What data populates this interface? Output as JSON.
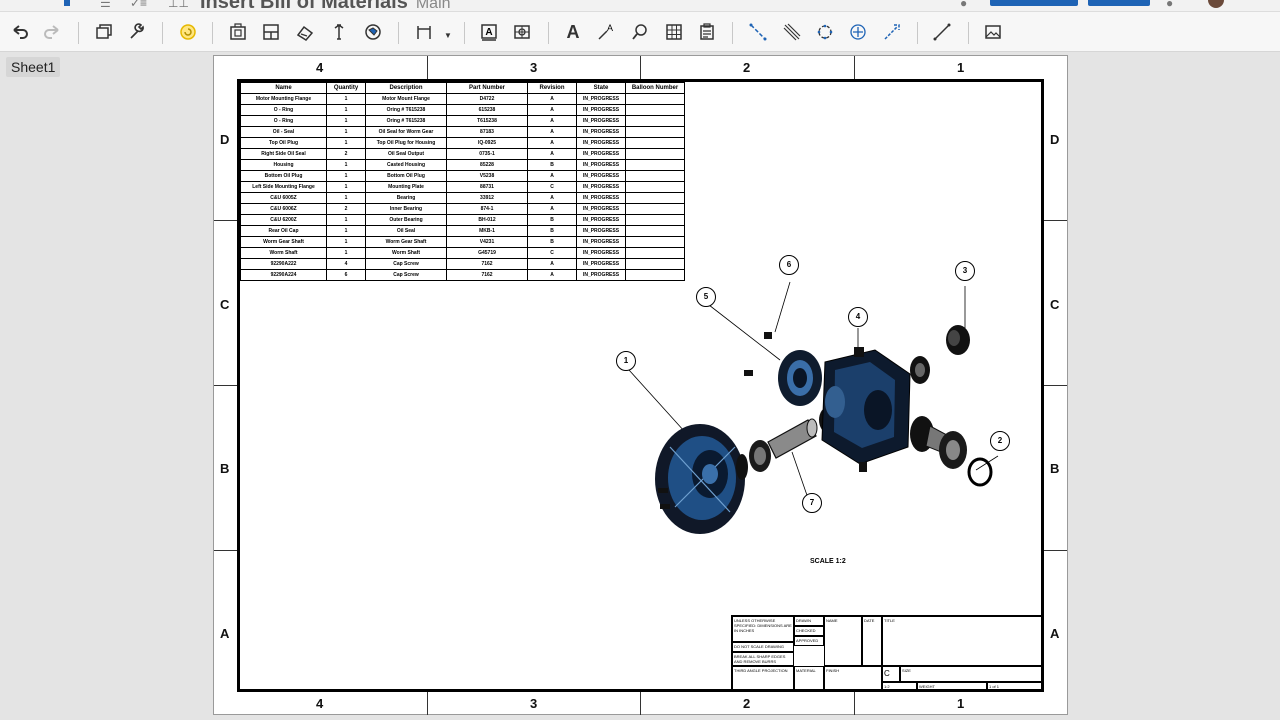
{
  "app": {
    "title": "Insert Bill of Materials",
    "subtitle": "Main",
    "colors": {
      "accent": "#1e63b5",
      "highlight_icon": "#e6b800"
    }
  },
  "toolbar": {
    "tools": [
      {
        "name": "undo-icon",
        "enabled": true
      },
      {
        "name": "redo-icon",
        "enabled": false
      },
      {
        "name": "insert-view-icon",
        "enabled": true
      },
      {
        "name": "wrench-icon",
        "enabled": true
      },
      {
        "name": "update-icon",
        "enabled": true
      },
      {
        "name": "insert-part-icon",
        "enabled": true
      },
      {
        "name": "section-view-icon",
        "enabled": true
      },
      {
        "name": "projected-view-icon",
        "enabled": true
      },
      {
        "name": "auxiliary-view-icon",
        "enabled": true
      },
      {
        "name": "detail-view-icon",
        "enabled": true
      },
      {
        "name": "dimension-icon",
        "enabled": true
      },
      {
        "name": "note-icon",
        "enabled": true
      },
      {
        "name": "datum-icon",
        "enabled": true
      },
      {
        "name": "text-icon",
        "enabled": true
      },
      {
        "name": "callout-icon",
        "enabled": true
      },
      {
        "name": "search-balloon-icon",
        "enabled": true
      },
      {
        "name": "table-icon",
        "enabled": true
      },
      {
        "name": "bom-table-icon",
        "enabled": true
      },
      {
        "name": "centerline-icon",
        "enabled": true
      },
      {
        "name": "hatch-icon",
        "enabled": true
      },
      {
        "name": "bolt-circle-icon",
        "enabled": true
      },
      {
        "name": "centermark-icon",
        "enabled": true
      },
      {
        "name": "leader-icon",
        "enabled": true
      },
      {
        "name": "line-icon",
        "enabled": true
      },
      {
        "name": "image-icon",
        "enabled": true
      }
    ]
  },
  "sheet": {
    "tab_label": "Sheet1",
    "zones_cols": [
      "4",
      "3",
      "2",
      "1"
    ],
    "zones_rows": [
      "D",
      "C",
      "B",
      "A"
    ],
    "scale_note": "SCALE 1:2"
  },
  "bom": {
    "headers": [
      "Name",
      "Quantity",
      "Description",
      "Part Number",
      "Revision",
      "State",
      "Balloon Number"
    ],
    "rows": [
      [
        "Motor Mounting Flange",
        "1",
        "Motor Mount Flange",
        "D4722",
        "A",
        "IN_PROGRESS",
        ""
      ],
      [
        "O - Ring",
        "1",
        "Oring # T615238",
        "615238",
        "A",
        "IN_PROGRESS",
        ""
      ],
      [
        "O - Ring",
        "1",
        "Oring # T615238",
        "T615238",
        "A",
        "IN_PROGRESS",
        ""
      ],
      [
        "Oil - Seal",
        "1",
        "Oil Seal for Worm Gear",
        "87183",
        "A",
        "IN_PROGRESS",
        ""
      ],
      [
        "Top Oil Plug",
        "1",
        "Top Oil Plug for Housing",
        "IQ-0925",
        "A",
        "IN_PROGRESS",
        ""
      ],
      [
        "Right Side Oil Seal",
        "2",
        "Oil Seal Output",
        "0735-1",
        "A",
        "IN_PROGRESS",
        ""
      ],
      [
        "Housing",
        "1",
        "Casted Housing",
        "85228",
        "B",
        "IN_PROGRESS",
        ""
      ],
      [
        "Bottom Oil Plug",
        "1",
        "Bottom Oil Plug",
        "V5238",
        "A",
        "IN_PROGRESS",
        ""
      ],
      [
        "Left Side Mounting Flange",
        "1",
        "Mounting Plate",
        "88731",
        "C",
        "IN_PROGRESS",
        ""
      ],
      [
        "C&U 6005Z",
        "1",
        "Bearing",
        "33912",
        "A",
        "IN_PROGRESS",
        ""
      ],
      [
        "C&U 6006Z",
        "2",
        "Inner Bearing",
        "874-1",
        "A",
        "IN_PROGRESS",
        ""
      ],
      [
        "C&U 6200Z",
        "1",
        "Outer Bearing",
        "BH-012",
        "B",
        "IN_PROGRESS",
        ""
      ],
      [
        "Rear Oil Cap",
        "1",
        "Oil Seal",
        "MKB-1",
        "B",
        "IN_PROGRESS",
        ""
      ],
      [
        "Worm Gear Shaft",
        "1",
        "Worm Gear Shaft",
        "V4231",
        "B",
        "IN_PROGRESS",
        ""
      ],
      [
        "Worm Shaft",
        "1",
        "Worm Shaft",
        "G45719",
        "C",
        "IN_PROGRESS",
        ""
      ],
      [
        "92290A222",
        "4",
        "Cap Screw",
        "7162",
        "A",
        "IN_PROGRESS",
        ""
      ],
      [
        "92290A224",
        "6",
        "Cap Screw",
        "7162",
        "A",
        "IN_PROGRESS",
        ""
      ]
    ]
  },
  "balloons": [
    "1",
    "2",
    "3",
    "4",
    "5",
    "6",
    "7"
  ],
  "titleblock": {
    "notes": "UNLESS OTHERWISE SPECIFIED: DIMENSIONS ARE IN INCHES",
    "do_not_scale": "DO NOT SCALE DRAWING",
    "break_edges": "BREAK ALL SHARP EDGES AND REMOVE BURRS",
    "projection": "THIRD ANGLE PROJECTION",
    "material_label": "MATERIAL",
    "finish_label": "FINISH",
    "name_label": "NAME",
    "date_label": "DATE",
    "drawn_label": "DRAWN",
    "checked_label": "CHECKED",
    "approved_label": "APPROVED",
    "title_label": "TITLE",
    "size_label": "SIZE",
    "size_value": "C",
    "scale_label": "SCALE",
    "scale_value": "1:2",
    "weight_label": "WEIGHT",
    "sheet_label": "SHEET",
    "sheet_value": "1 of 1"
  }
}
